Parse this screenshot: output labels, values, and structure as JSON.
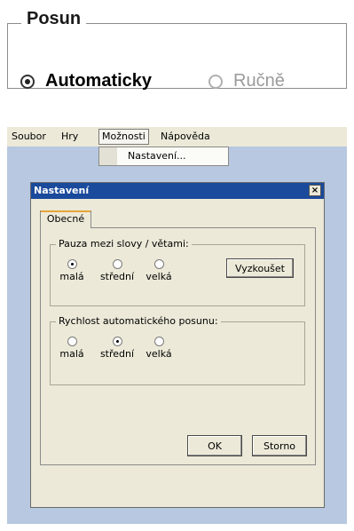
{
  "zoom": {
    "legend": "Posun",
    "option_auto": "Automaticky",
    "option_manual": "Ručně"
  },
  "menubar": {
    "items": [
      "Soubor",
      "Hry",
      "Možnosti",
      "Nápověda"
    ],
    "dropdown_item": "Nastavení..."
  },
  "dialog": {
    "title": "Nastavení",
    "close": "×",
    "tab": "Obecné",
    "pause_group": {
      "legend": "Pauza mezi slovy / větami:",
      "options": [
        "malá",
        "střední",
        "velká"
      ],
      "selected": "malá",
      "try_button": "Vyzkoušet"
    },
    "speed_group": {
      "legend": "Rychlost automatického posunu:",
      "options": [
        "malá",
        "střední",
        "velká"
      ],
      "selected": "střední"
    },
    "ok_button": "OK",
    "cancel_button": "Storno"
  }
}
